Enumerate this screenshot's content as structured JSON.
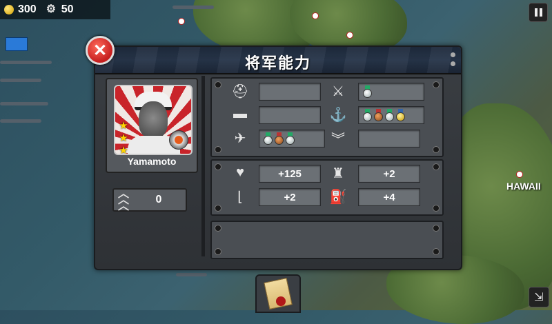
{
  "hud": {
    "gold": "300",
    "gears": "50"
  },
  "map": {
    "location_label": "HAWAII"
  },
  "panel": {
    "title": "将军能力",
    "general": {
      "name": "Yamamoto",
      "stars": "★★★",
      "rank_value": "0"
    },
    "equipment": {
      "infantry_slot": "",
      "artillery_medals": [
        "silver"
      ],
      "tank_slot": "",
      "navy_medals": [
        "silver",
        "bronze",
        "silver",
        "gold"
      ],
      "air_medals": [
        "silver",
        "bronze",
        "silver"
      ],
      "rank_slot": ""
    },
    "bonuses": {
      "health": "+125",
      "fortification": "+2",
      "movement": "+2",
      "supply": "+4"
    },
    "description": ""
  },
  "icons": {
    "close": "close-icon",
    "pause": "pause-icon",
    "gold": "coin-icon",
    "gear": "gear-icon",
    "helmet": "helmet-icon",
    "cannon": "cannon-icon",
    "tank": "tank-icon",
    "anchor": "anchor-icon",
    "plane": "plane-icon",
    "rank": "chevron-rank-icon",
    "heart": "heart-icon",
    "castle": "castle-icon",
    "boot": "boot-icon",
    "fuel": "fuel-can-icon",
    "scroll": "scroll-icon"
  },
  "colors": {
    "close_red": "#c51e1e",
    "panel_bg": "#3a3e43",
    "title_bar": "#1e2a3c"
  }
}
